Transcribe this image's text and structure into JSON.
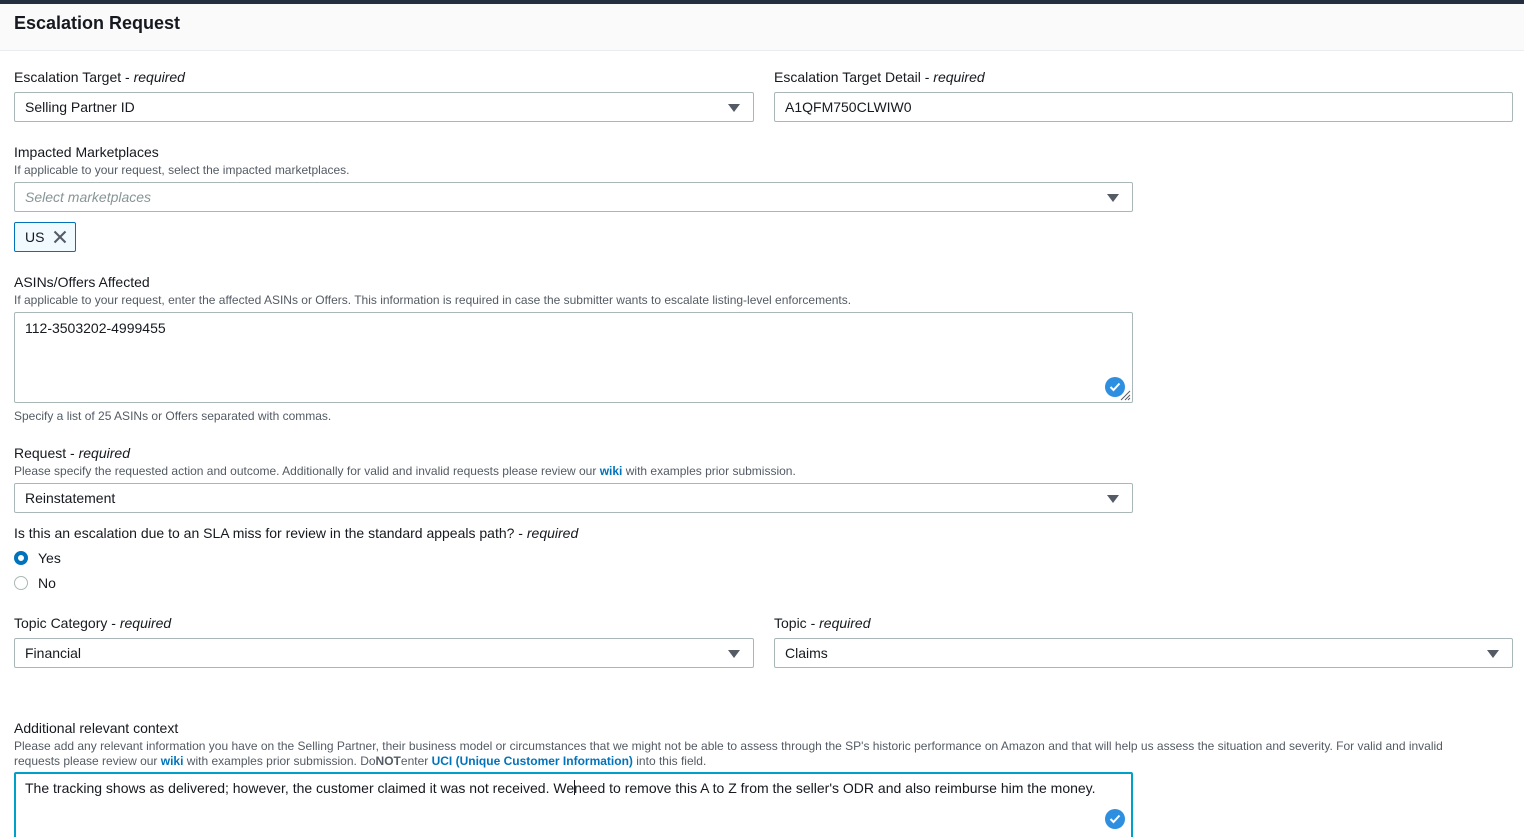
{
  "header": {
    "title": "Escalation Request"
  },
  "escalation_target": {
    "label": "Escalation Target",
    "required_label": "required",
    "value": "Selling Partner ID"
  },
  "escalation_target_detail": {
    "label": "Escalation Target Detail",
    "required_label": "required",
    "value": "A1QFM750CLWIW0"
  },
  "marketplaces": {
    "label": "Impacted Marketplaces",
    "description": "If applicable to your request, select the impacted marketplaces.",
    "placeholder": "Select marketplaces",
    "selected_tokens": [
      "US"
    ]
  },
  "asins": {
    "label": "ASINs/Offers Affected",
    "description": "If applicable to your request, enter the affected ASINs or Offers. This information is required in case the submitter wants to escalate listing-level enforcements.",
    "value": "112-3503202-4999455",
    "constraint": "Specify a list of 25 ASINs or Offers separated with commas."
  },
  "request": {
    "label": "Request",
    "required_label": "required",
    "description_before": "Please specify the requested action and outcome. Additionally for valid and invalid requests please review our",
    "wiki_link": "wiki",
    "description_after": "with examples prior submission.",
    "value": "Reinstatement"
  },
  "sla_question": {
    "label": "Is this an escalation due to an SLA miss for review in the standard appeals path?",
    "required_label": "required",
    "options": [
      "Yes",
      "No"
    ],
    "selected": "Yes"
  },
  "topic_category": {
    "label": "Topic Category",
    "required_label": "required",
    "value": "Financial"
  },
  "topic": {
    "label": "Topic",
    "required_label": "required",
    "value": "Claims"
  },
  "context": {
    "label": "Additional relevant context",
    "description_line1": "Please add any relevant information you have on the Selling Partner, their business model or circumstances that we might not be able to assess through the SP's historic performance on Amazon and that will help us assess the situation and severity. For valid and invalid",
    "description_line2_before": "requests please review our",
    "wiki_link": "wiki",
    "description_line2_mid": "with examples prior submission. Do",
    "not_text": "NOT",
    "enter_text": "enter",
    "uci_link": "UCI (Unique Customer Information)",
    "description_line2_after": "into this field.",
    "value_before_cursor": "The tracking shows as delivered; however, the customer claimed it was not received. We",
    "value_after_cursor": "need to remove this A to Z from the seller's ODR and also reimburse him the money."
  },
  "colors": {
    "link": "#0073bb",
    "focus_border": "#00a1c9",
    "token_bg": "#f1faff",
    "check_badge": "#2e8ee0"
  }
}
